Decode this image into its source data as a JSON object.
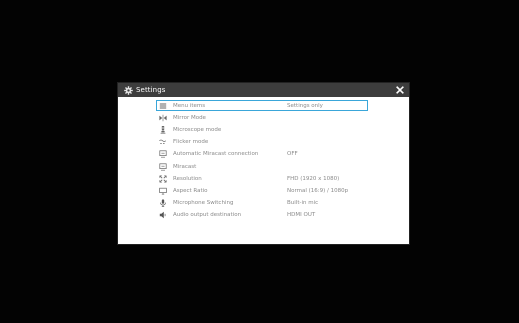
{
  "window": {
    "title": "Settings",
    "icon": "gear-icon",
    "close_icon": "close-icon"
  },
  "colors": {
    "titlebar_bg": "#3d3d3d",
    "selection_border": "#3aa6d9",
    "text": "#8a8a8a",
    "background": "#030303"
  },
  "settings": {
    "items": [
      {
        "icon": "menu-icon",
        "label": "Menu items",
        "value": "Settings only",
        "selected": true
      },
      {
        "icon": "mirror-icon",
        "label": "Mirror Mode",
        "value": ""
      },
      {
        "icon": "microscope-icon",
        "label": "Microscope mode",
        "value": ""
      },
      {
        "icon": "flicker-icon",
        "label": "Flicker mode",
        "value": ""
      },
      {
        "icon": "cast-icon",
        "label": "Automatic Miracast connection",
        "value": "OFF"
      },
      {
        "icon": "cast-icon",
        "label": "Miracast",
        "value": ""
      },
      {
        "icon": "resolution-icon",
        "label": "Resolution",
        "value": "FHD (1920 x 1080)"
      },
      {
        "icon": "monitor-icon",
        "label": "Aspect Ratio",
        "value": "Normal (16:9) / 1080p"
      },
      {
        "icon": "microphone-icon",
        "label": "Microphone Switching",
        "value": "Built-in mic"
      },
      {
        "icon": "speaker-icon",
        "label": "Audio output destination",
        "value": "HDMI OUT"
      }
    ]
  }
}
